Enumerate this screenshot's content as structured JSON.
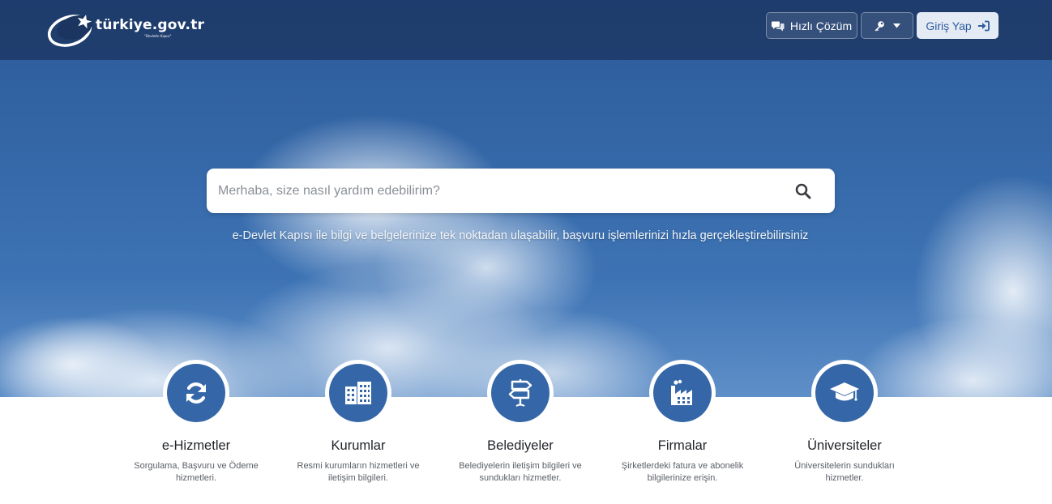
{
  "header": {
    "logo_text": "türkiye.gov.tr",
    "logo_subtext": "\"Devletin Kapısı\"",
    "quick_solution_label": "Hızlı Çözüm",
    "login_label": "Giriş Yap"
  },
  "search": {
    "placeholder": "Merhaba, size nasıl yardım edebilirim?",
    "value": ""
  },
  "tagline": "e-Devlet Kapısı ile bilgi ve belgelerinize tek noktadan ulaşabilir, başvuru işlemlerinizi hızla gerçekleştirebilirsiniz",
  "categories": [
    {
      "title": "e-Hizmetler",
      "description": "Sorgulama, Başvuru ve Ödeme hizmetleri.",
      "icon": "refresh-icon"
    },
    {
      "title": "Kurumlar",
      "description": "Resmi kurumların hizmetleri ve iletişim bilgileri.",
      "icon": "building-icon"
    },
    {
      "title": "Belediyeler",
      "description": "Belediyelerin iletişim bilgileri ve sundukları hizmetler.",
      "icon": "signpost-icon"
    },
    {
      "title": "Firmalar",
      "description": "Şirketlerdeki fatura ve abonelik bilgilerinize erişin.",
      "icon": "factory-icon"
    },
    {
      "title": "Üniversiteler",
      "description": "Üniversitelerin sundukları hizmetler.",
      "icon": "graduation-cap-icon"
    }
  ],
  "colors": {
    "header_bg": "#1b3560",
    "accent": "#3567a8",
    "login_bg": "#e4ebf5"
  }
}
